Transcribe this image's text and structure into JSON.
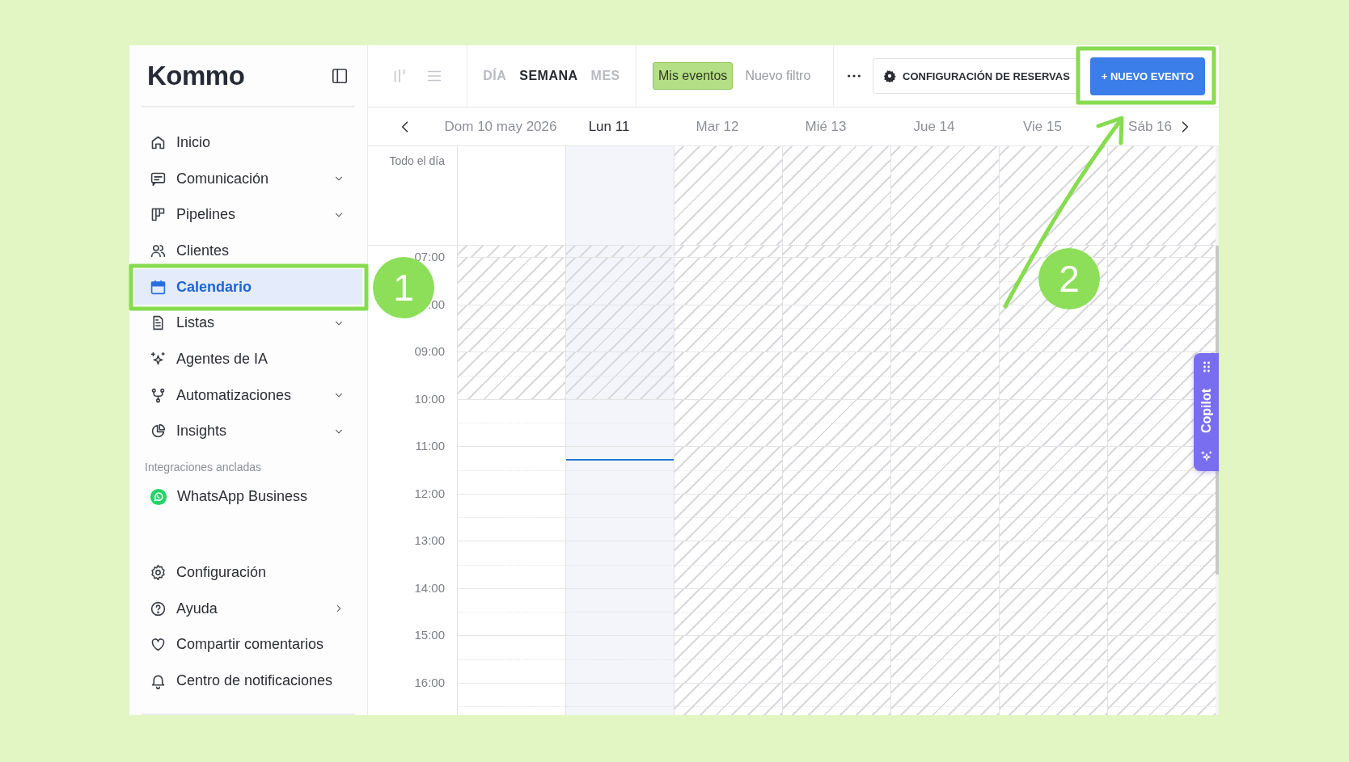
{
  "sidebar": {
    "logo": "Kommo",
    "items": [
      {
        "label": "Inicio",
        "kind": "link",
        "selected": false
      },
      {
        "label": "Comunicación",
        "kind": "group",
        "selected": false
      },
      {
        "label": "Pipelines",
        "kind": "group",
        "selected": false
      },
      {
        "label": "Clientes",
        "kind": "link",
        "selected": false
      },
      {
        "label": "Calendario",
        "kind": "link",
        "selected": true
      },
      {
        "label": "Listas",
        "kind": "group",
        "selected": false
      },
      {
        "label": "Agentes de IA",
        "kind": "link",
        "selected": false
      },
      {
        "label": "Automatizaciones",
        "kind": "group",
        "selected": false
      },
      {
        "label": "Insights",
        "kind": "group",
        "selected": false
      }
    ],
    "section_label": "Integraciones ancladas",
    "pinned": [
      {
        "label": "WhatsApp Business"
      }
    ],
    "footer_items": [
      {
        "label": "Configuración",
        "kind": "link",
        "selected": false
      },
      {
        "label": "Ayuda",
        "kind": "submenu",
        "selected": false
      },
      {
        "label": "Compartir comentarios",
        "kind": "link",
        "selected": false
      },
      {
        "label": "Centro de notificaciones",
        "kind": "link",
        "selected": false
      }
    ]
  },
  "toolbar": {
    "view_tabs": [
      {
        "label": "DÍA",
        "selected": false
      },
      {
        "label": "SEMANA",
        "selected": true
      },
      {
        "label": "MES",
        "selected": false
      }
    ],
    "filters": [
      {
        "label": "Mis eventos",
        "selected": true
      },
      {
        "label": "Nuevo filtro",
        "selected": false
      }
    ],
    "booking_button": "CONFIGURACIÓN DE RESERVAS",
    "new_event_button": "+ NUEVO EVENTO"
  },
  "calendar": {
    "all_day_label": "Todo el día",
    "days": [
      {
        "label": "Dom 10 may 2026",
        "today": false,
        "unavailable": false,
        "now_line": false
      },
      {
        "label": "Lun 11",
        "today": true,
        "unavailable": false,
        "now_line": true
      },
      {
        "label": "Mar 12",
        "today": false,
        "unavailable": true,
        "now_line": false
      },
      {
        "label": "Mié 13",
        "today": false,
        "unavailable": true,
        "now_line": false
      },
      {
        "label": "Jue 14",
        "today": false,
        "unavailable": true,
        "now_line": false
      },
      {
        "label": "Vie 15",
        "today": false,
        "unavailable": true,
        "now_line": false
      },
      {
        "label": "Sáb 16",
        "today": false,
        "unavailable": true,
        "now_line": false
      }
    ],
    "hours": [
      {
        "label": "07:00",
        "off": true
      },
      {
        "label": ":00",
        "off": true
      },
      {
        "label": "09:00",
        "off": true
      },
      {
        "label": "10:00",
        "off": false
      },
      {
        "label": "11:00",
        "off": false
      },
      {
        "label": "12:00",
        "off": false
      },
      {
        "label": "13:00",
        "off": false
      },
      {
        "label": "14:00",
        "off": false
      },
      {
        "label": "15:00",
        "off": false
      },
      {
        "label": "16:00",
        "off": false
      }
    ]
  },
  "copilot": {
    "label": "Copilot"
  },
  "annotations": [
    {
      "number": "1"
    },
    {
      "number": "2"
    }
  ]
}
